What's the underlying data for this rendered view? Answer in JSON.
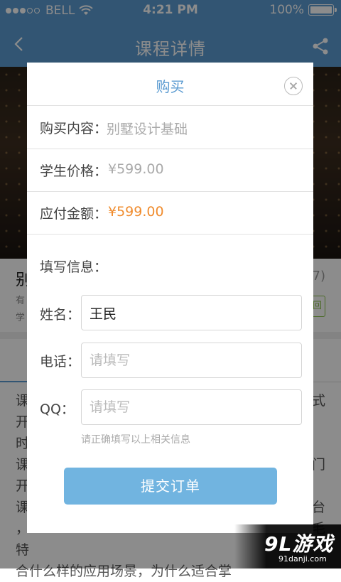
{
  "status_bar": {
    "carrier": "BELL",
    "time": "4:21 PM",
    "battery": "100%"
  },
  "nav": {
    "title": "课程详情"
  },
  "background": {
    "course_title": "别",
    "count": "7)",
    "sub1": "有",
    "sub2": "学",
    "tag": "回",
    "text_lines": [
      "课",
      "开",
      "时",
      "课",
      "开",
      "课",
      "，",
      "特",
      "合什么样的应用场景，为什么适合掌"
    ],
    "text_right": [
      "式",
      "",
      "",
      "",
      "门",
      "",
      "台",
      "毛"
    ]
  },
  "modal": {
    "title": "购买",
    "content_label": "购买内容：",
    "content_value": "别墅设计基础",
    "student_price_label": "学生价格：",
    "student_price_value": "¥599.00",
    "amount_label": "应付金额：",
    "amount_value": "¥599.00",
    "info_label": "填写信息：",
    "name_label": "姓名：",
    "name_value": "王民",
    "phone_label": "电话：",
    "phone_placeholder": "请填写",
    "qq_label": "QQ：",
    "qq_placeholder": "请填写",
    "hint": "请正确填写以上相关信息",
    "submit_label": "提交订单"
  },
  "watermark": {
    "main": "9L游戏",
    "sub": "91danji.com"
  },
  "colors": {
    "brand": "#5b9bd1",
    "price": "#f08c2e",
    "button": "#71b4e0"
  }
}
